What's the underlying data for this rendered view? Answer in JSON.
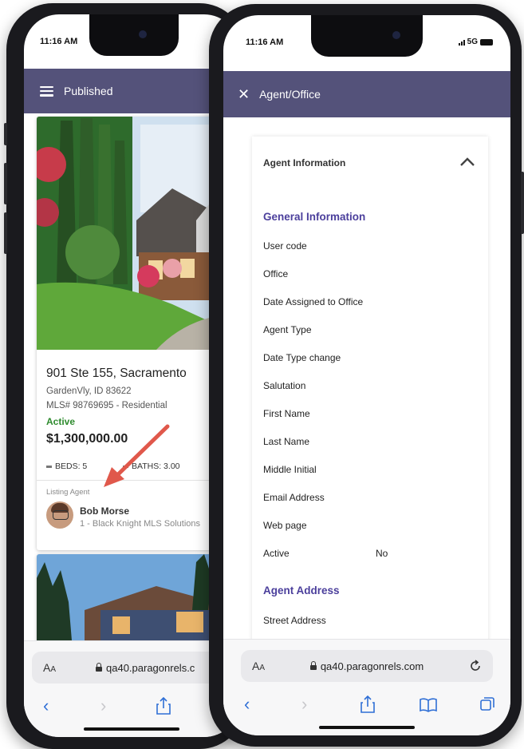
{
  "left_screen": {
    "status_time": "11:16 AM",
    "appbar_title": "Published",
    "listing": {
      "address": "901 Ste 155, Sacramento",
      "city_line": "GardenVly, ID 83622",
      "mls_line": "MLS# 98769695 - Residential",
      "status": "Active",
      "price": "$1,300,000.00",
      "beds": "BEDS: 5",
      "baths": "BATHS: 3.00",
      "agent_label": "Listing Agent",
      "agent_name": "Bob Morse",
      "agent_office": "1 - Black Knight MLS Solutions"
    },
    "url": "qa40.paragonrels.c",
    "aa_label": "A",
    "aa_small": "A"
  },
  "right_screen": {
    "status_time": "11:16 AM",
    "signal": "5G",
    "appbar_title": "Agent/Office",
    "panel_header": "Agent Information",
    "section_general": "General Information",
    "fields": [
      "User code",
      "Office",
      "Date Assigned to Office",
      "Agent Type",
      "Date Type change",
      "Salutation",
      "First Name",
      "Last Name",
      "Middle Initial",
      "Email Address",
      "Web page",
      "Active"
    ],
    "active_value": "No",
    "section_address": "Agent Address",
    "street_label": "Street Address",
    "url": "qa40.paragonrels.com",
    "aa_label": "A",
    "aa_small": "A"
  },
  "colors": {
    "appbar": "#54527a",
    "accent": "#4b3f9c",
    "status_active": "#2e8b2e",
    "arrow": "#e0584b",
    "safari_blue": "#2f6fd6"
  },
  "icons": [
    "hamburger-icon",
    "close-icon",
    "chevron-up-icon",
    "lock-icon",
    "reload-icon",
    "back-icon",
    "forward-icon",
    "share-icon",
    "bookmarks-icon",
    "tabs-icon",
    "bed-icon",
    "bath-icon"
  ]
}
